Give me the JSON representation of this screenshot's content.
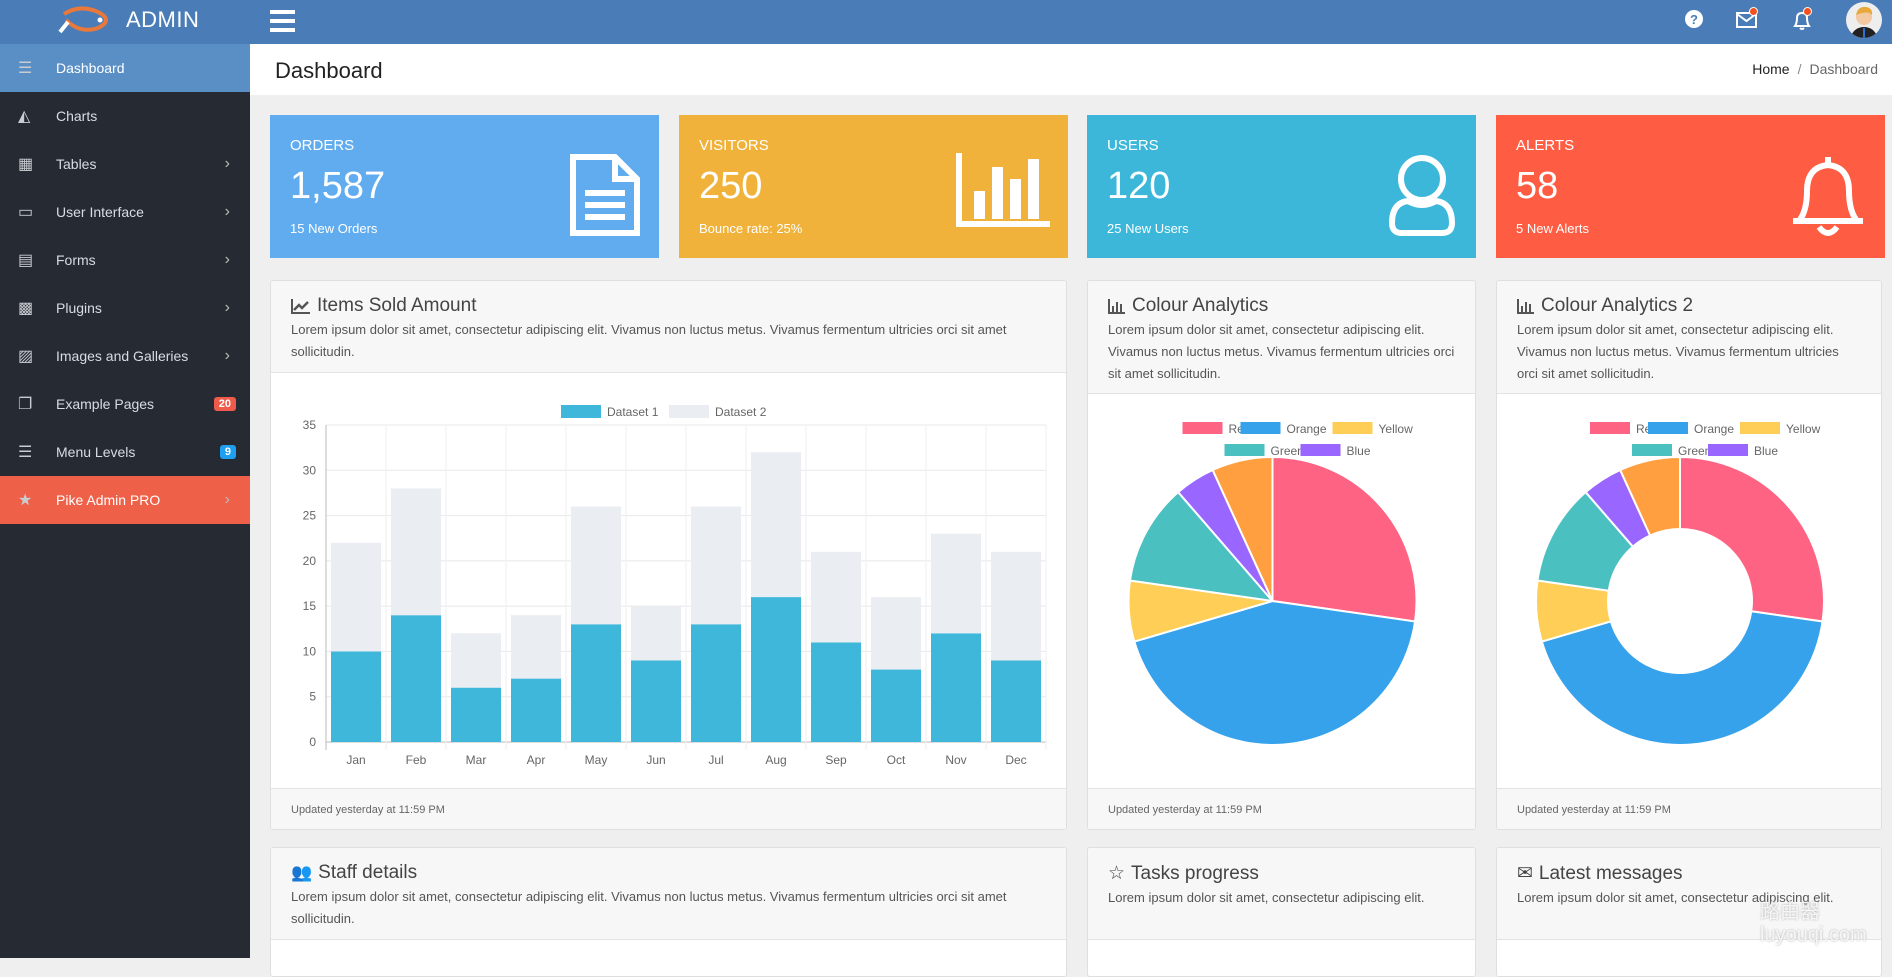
{
  "header": {
    "brand": "ADMIN",
    "icons": [
      "help-icon",
      "mail-icon",
      "bell-icon"
    ]
  },
  "sidebar": {
    "items": [
      {
        "label": "Dashboard",
        "icon": "bars-icon",
        "active": true
      },
      {
        "label": "Charts",
        "icon": "area-chart-icon"
      },
      {
        "label": "Tables",
        "icon": "table-icon",
        "chevron": true
      },
      {
        "label": "User Interface",
        "icon": "desktop-icon",
        "chevron": true
      },
      {
        "label": "Forms",
        "icon": "file-text-icon",
        "chevron": true
      },
      {
        "label": "Plugins",
        "icon": "grid-icon",
        "chevron": true
      },
      {
        "label": "Images and Galleries",
        "icon": "image-icon",
        "chevron": true
      },
      {
        "label": "Example Pages",
        "icon": "copy-icon",
        "badge": "20",
        "badge_color": "#ef5b4b"
      },
      {
        "label": "Menu Levels",
        "icon": "indent-icon",
        "badge": "9",
        "badge_color": "#1e9ff2"
      },
      {
        "label": "Pike Admin PRO",
        "icon": "star-icon",
        "chevron": true
      }
    ]
  },
  "page": {
    "title": "Dashboard",
    "breadcrumb": [
      "Home",
      "Dashboard"
    ]
  },
  "stats": [
    {
      "label": "ORDERS",
      "value": "1,587",
      "sub": "15 New Orders",
      "color": "#60acee",
      "icon": "file-text-icon"
    },
    {
      "label": "VISITORS",
      "value": "250",
      "sub": "Bounce rate: 25%",
      "color": "#f0b23a",
      "icon": "bar-chart-icon"
    },
    {
      "label": "USERS",
      "value": "120",
      "sub": "25 New Users",
      "color": "#3cb7da",
      "icon": "user-icon"
    },
    {
      "label": "ALERTS",
      "value": "58",
      "sub": "5 New Alerts",
      "color": "#fe5d43",
      "icon": "bell-icon"
    }
  ],
  "cards": {
    "items_sold": {
      "title": "Items Sold Amount",
      "desc": "Lorem ipsum dolor sit amet, consectetur adipiscing elit. Vivamus non luctus metus. Vivamus fermentum ultricies orci sit amet sollicitudin.",
      "footer": "Updated yesterday at 11:59 PM"
    },
    "colour1": {
      "title": "Colour Analytics",
      "desc": "Lorem ipsum dolor sit amet, consectetur adipiscing elit. Vivamus non luctus metus. Vivamus fermentum ultricies orci sit amet sollicitudin.",
      "footer": "Updated yesterday at 11:59 PM"
    },
    "colour2": {
      "title": "Colour Analytics 2",
      "desc": "Lorem ipsum dolor sit amet, consectetur adipiscing elit. Vivamus non luctus metus. Vivamus fermentum ultricies orci sit amet sollicitudin.",
      "footer": "Updated yesterday at 11:59 PM"
    },
    "staff": {
      "title": "Staff details",
      "desc": "Lorem ipsum dolor sit amet, consectetur adipiscing elit. Vivamus non luctus metus. Vivamus fermentum ultricies orci sit amet sollicitudin."
    },
    "tasks": {
      "title": "Tasks progress",
      "desc": "Lorem ipsum dolor sit amet, consectetur adipiscing elit."
    },
    "messages": {
      "title": "Latest messages",
      "desc": "Lorem ipsum dolor sit amet, consectetur adipiscing elit."
    }
  },
  "watermark": "路由器 luyouqi.com",
  "chart_data": [
    {
      "type": "bar",
      "stacked": true,
      "categories": [
        "Jan",
        "Feb",
        "Mar",
        "Apr",
        "May",
        "Jun",
        "Jul",
        "Aug",
        "Sep",
        "Oct",
        "Nov",
        "Dec"
      ],
      "series": [
        {
          "name": "Dataset 1",
          "color": "#3eb7da",
          "values": [
            10,
            14,
            6,
            7,
            13,
            9,
            13,
            16,
            11,
            8,
            12,
            9
          ]
        },
        {
          "name": "Dataset 2",
          "color": "#eaedf1",
          "values": [
            12,
            14,
            6,
            7,
            13,
            6,
            13,
            16,
            10,
            8,
            11,
            12
          ]
        }
      ],
      "ylim": [
        0,
        35
      ],
      "yticks": [
        0,
        5,
        10,
        15,
        20,
        25,
        30,
        35
      ],
      "grid": true,
      "legend": "top"
    },
    {
      "type": "pie",
      "labels": [
        "Red",
        "Orange",
        "Yellow",
        "Green",
        "Blue"
      ],
      "values": [
        12,
        19,
        3,
        5,
        2,
        3
      ],
      "colors": [
        "#ff6384",
        "#36a2eb",
        "#ffce56",
        "#4bc0c0",
        "#9966ff",
        "#ff9f40"
      ],
      "legend": "top"
    },
    {
      "type": "doughnut",
      "labels": [
        "Red",
        "Orange",
        "Yellow",
        "Green",
        "Blue"
      ],
      "values": [
        12,
        19,
        3,
        5,
        2,
        3
      ],
      "colors": [
        "#ff6384",
        "#36a2eb",
        "#ffce56",
        "#4bc0c0",
        "#9966ff",
        "#ff9f40"
      ],
      "legend": "top"
    }
  ]
}
